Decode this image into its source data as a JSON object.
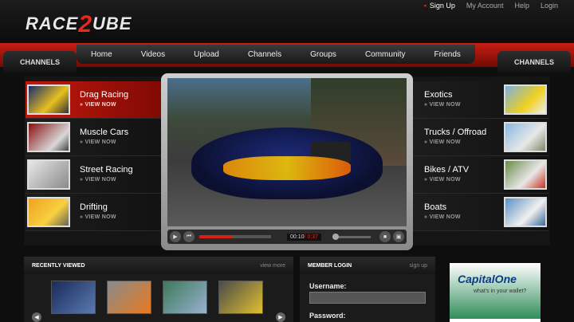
{
  "site": {
    "logo_left": "RACE",
    "logo_mid": "2",
    "logo_right": "UBE"
  },
  "toplinks": [
    "Sign Up",
    "My Account",
    "Help",
    "Login"
  ],
  "nav": [
    "Home",
    "Videos",
    "Upload",
    "Channels",
    "Groups",
    "Community",
    "Friends"
  ],
  "channels_label_left": "CHANNELS",
  "channels_label_right": "CHANNELS",
  "left_channels": [
    {
      "name": "Drag Racing",
      "view": "» VIEW NOW",
      "active": true
    },
    {
      "name": "Muscle Cars",
      "view": "» VIEW NOW",
      "active": false
    },
    {
      "name": "Street Racing",
      "view": "» VIEW NOW",
      "active": false
    },
    {
      "name": "Drifting",
      "view": "» VIEW NOW",
      "active": false
    }
  ],
  "right_channels": [
    {
      "name": "Exotics",
      "view": "» VIEW NOW"
    },
    {
      "name": "Trucks / Offroad",
      "view": "» VIEW NOW"
    },
    {
      "name": "Bikes / ATV",
      "view": "» VIEW NOW"
    },
    {
      "name": "Boats",
      "view": "» VIEW NOW"
    }
  ],
  "player": {
    "elapsed": "00:10",
    "total": "/ 0:37",
    "progress": 0.45,
    "volume": 0.0
  },
  "recent": {
    "title": "RECENTLY VIEWED",
    "more": "view more"
  },
  "member": {
    "title": "MEMBER LOGIN",
    "signup": "sign up",
    "username_label": "Username:",
    "password_label": "Password:"
  },
  "ad": {
    "brand": "CapitalOne",
    "tagline": "what's in your wallet?"
  },
  "colors": {
    "accent": "#e42a1c"
  }
}
